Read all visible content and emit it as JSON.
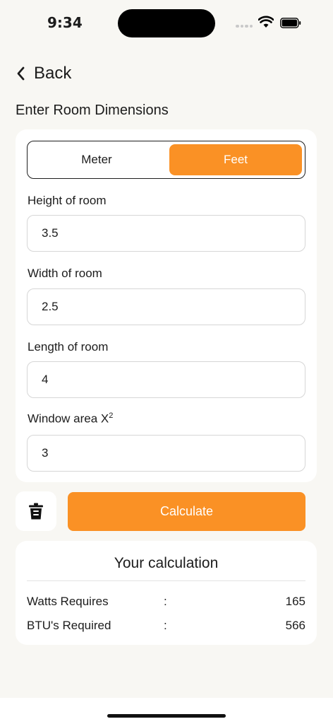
{
  "status_bar": {
    "time": "9:34"
  },
  "nav": {
    "back_label": "Back"
  },
  "section_title": "Enter Room Dimensions",
  "unit_toggle": {
    "options": [
      "Meter",
      "Feet"
    ],
    "selected": "Feet"
  },
  "fields": {
    "height": {
      "label": "Height of room",
      "value": "3.5"
    },
    "width": {
      "label": "Width of room",
      "value": "2.5"
    },
    "length": {
      "label": "Length of room",
      "value": "4"
    },
    "window": {
      "label": "Window area X",
      "label_sup": "2",
      "value": "3"
    }
  },
  "actions": {
    "calculate_label": "Calculate"
  },
  "result": {
    "title": "Your calculation",
    "rows": [
      {
        "label": "Watts Requires",
        "sep": ":",
        "value": "165"
      },
      {
        "label": "BTU's Required",
        "sep": ":",
        "value": "566"
      }
    ]
  },
  "colors": {
    "accent": "#fa9125",
    "background": "#f8f7f3",
    "card": "#ffffff"
  }
}
